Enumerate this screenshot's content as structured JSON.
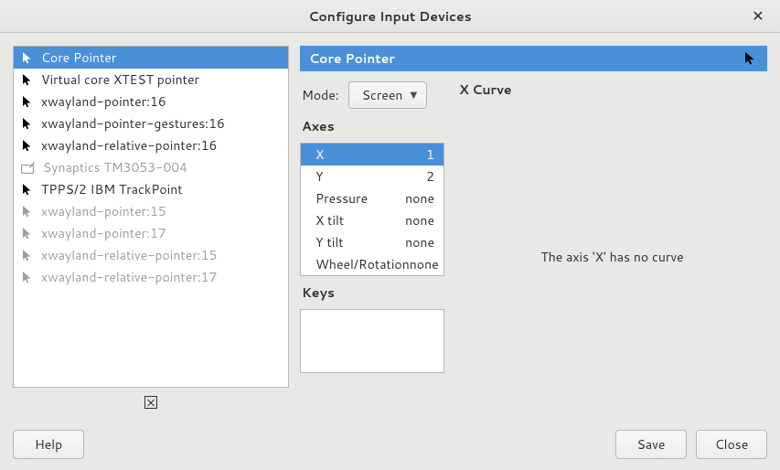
{
  "window": {
    "title": "Configure Input Devices",
    "close_tooltip": "Close"
  },
  "devices": [
    {
      "icon": "cursor",
      "label": "Core Pointer",
      "state": "selected"
    },
    {
      "icon": "cursor",
      "label": "Virtual core XTEST pointer",
      "state": "normal"
    },
    {
      "icon": "cursor",
      "label": "xwayland-pointer:16",
      "state": "normal"
    },
    {
      "icon": "cursor",
      "label": "xwayland-pointer-gestures:16",
      "state": "normal"
    },
    {
      "icon": "cursor",
      "label": "xwayland-relative-pointer:16",
      "state": "normal"
    },
    {
      "icon": "tablet",
      "label": "Synaptics TM3053-004",
      "state": "disabled"
    },
    {
      "icon": "cursor",
      "label": "TPPS/2 IBM TrackPoint",
      "state": "normal"
    },
    {
      "icon": "cursor",
      "label": "xwayland-pointer:15",
      "state": "disabled"
    },
    {
      "icon": "cursor",
      "label": "xwayland-pointer:17",
      "state": "disabled"
    },
    {
      "icon": "cursor",
      "label": "xwayland-relative-pointer:15",
      "state": "disabled"
    },
    {
      "icon": "cursor",
      "label": "xwayland-relative-pointer:17",
      "state": "disabled"
    }
  ],
  "detail": {
    "title": "Core Pointer",
    "mode_label": "Mode:",
    "mode_value": "Screen",
    "axes_label": "Axes",
    "axes": [
      {
        "name": "X",
        "value": "1",
        "selected": true
      },
      {
        "name": "Y",
        "value": "2",
        "selected": false
      },
      {
        "name": "Pressure",
        "value": "none",
        "selected": false
      },
      {
        "name": "X tilt",
        "value": "none",
        "selected": false
      },
      {
        "name": "Y tilt",
        "value": "none",
        "selected": false
      },
      {
        "name": "Wheel/Rotation",
        "value": "none",
        "selected": false
      }
    ],
    "keys_label": "Keys",
    "curve_title": "X Curve",
    "curve_message": "The axis 'X' has no curve"
  },
  "buttons": {
    "help": "Help",
    "save": "Save",
    "close": "Close"
  },
  "colors": {
    "accent": "#4a90d9",
    "bg": "#e8e8e7"
  }
}
